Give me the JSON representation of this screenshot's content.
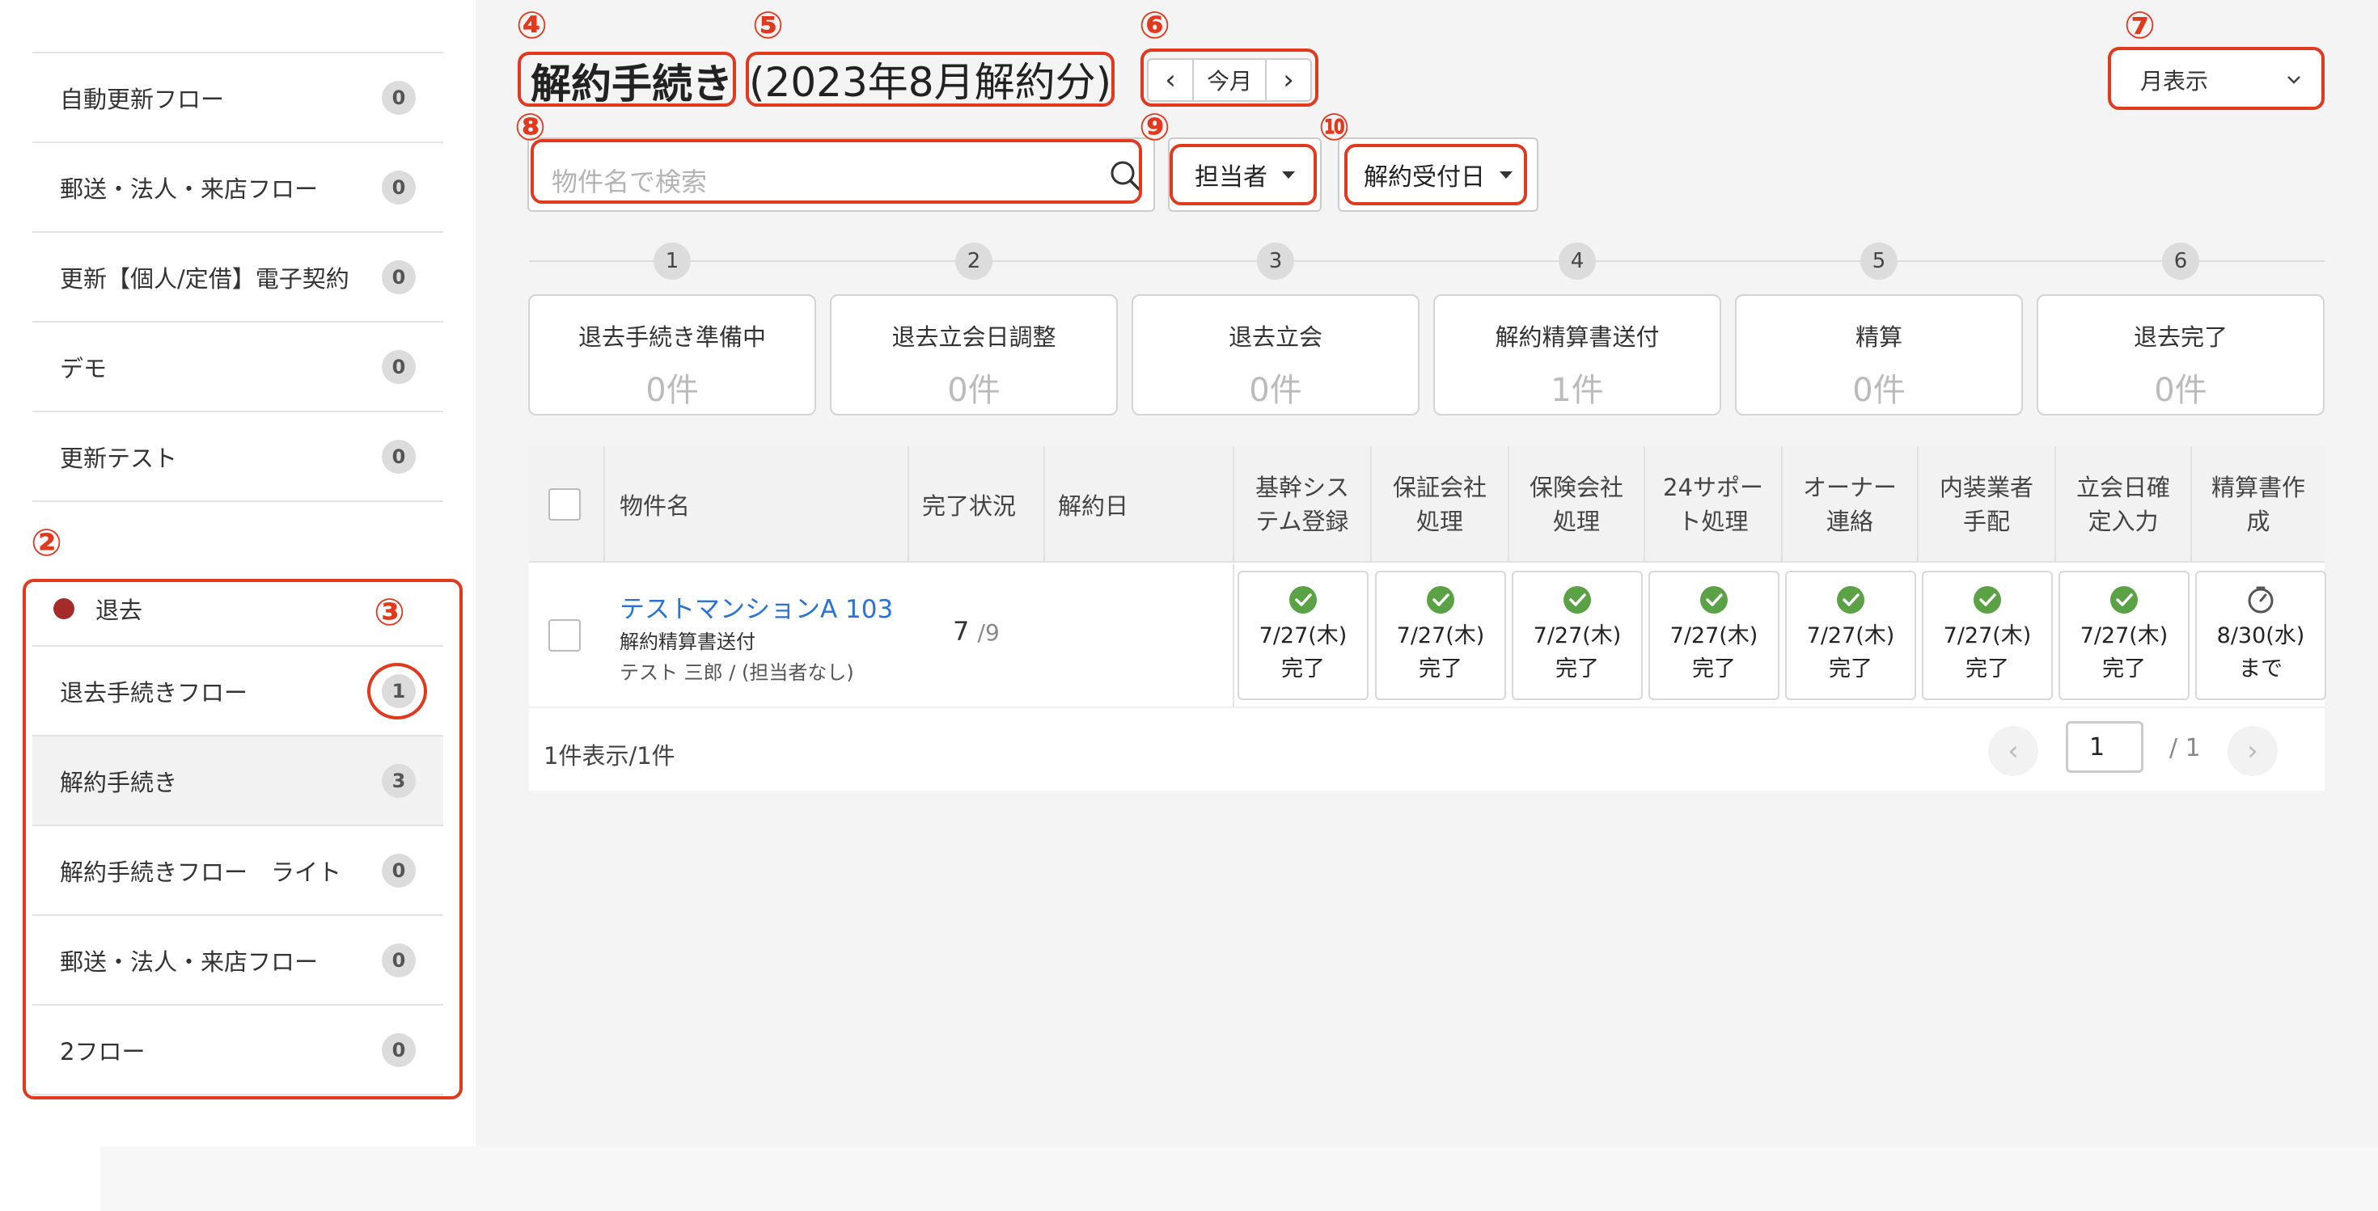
{
  "sidebar": {
    "items_top": [
      {
        "label": "自動更新フロー",
        "count": "0"
      },
      {
        "label": "郵送・法人・来店フロー",
        "count": "0"
      },
      {
        "label": "更新【個人/定借】電子契約",
        "count": "0"
      },
      {
        "label": "デモ",
        "count": "0"
      },
      {
        "label": "更新テスト",
        "count": "0"
      }
    ],
    "group_label": "退去",
    "group_color": "#a52a2a",
    "items_group": [
      {
        "label": "退去手続きフロー",
        "count": "1"
      },
      {
        "label": "解約手続き",
        "count": "3"
      },
      {
        "label": "解約手続きフロー　ライト",
        "count": "0"
      },
      {
        "label": "郵送・法人・来店フロー",
        "count": "0"
      },
      {
        "label": "2フロー",
        "count": "0"
      }
    ]
  },
  "annotations": {
    "n2": "②",
    "n3": "③",
    "n4": "④",
    "n5": "⑤",
    "n6": "⑥",
    "n7": "⑦",
    "n8": "⑧",
    "n9": "⑨",
    "n10": "⑩",
    "color": "#e0391e"
  },
  "header": {
    "title": "解約手続き",
    "period": "(2023年8月解約分)",
    "prev": "‹",
    "today": "今月",
    "next": "›",
    "view_mode": "月表示"
  },
  "filters": {
    "search_placeholder": "物件名で検索",
    "assignee": "担当者",
    "date_type": "解約受付日"
  },
  "steps": [
    {
      "num": "1",
      "label": "退去手続き準備中",
      "count": "0件"
    },
    {
      "num": "2",
      "label": "退去立会日調整",
      "count": "0件"
    },
    {
      "num": "3",
      "label": "退去立会",
      "count": "0件"
    },
    {
      "num": "4",
      "label": "解約精算書送付",
      "count": "1件"
    },
    {
      "num": "5",
      "label": "精算",
      "count": "0件"
    },
    {
      "num": "6",
      "label": "退去完了",
      "count": "0件"
    }
  ],
  "table": {
    "headers": {
      "name": "物件名",
      "progress": "完了状況",
      "cancel_date": "解約日",
      "tasks": [
        [
          "基幹シス",
          "テム登録"
        ],
        [
          "保証会社",
          "処理"
        ],
        [
          "保険会社",
          "処理"
        ],
        [
          "24サポー",
          "ト処理"
        ],
        [
          "オーナー",
          "連絡"
        ],
        [
          "内装業者",
          "手配"
        ],
        [
          "立会日確",
          "定入力"
        ],
        [
          "精算書作",
          "成"
        ]
      ]
    },
    "rows": [
      {
        "name": "テストマンションA  103",
        "status": "解約精算書送付",
        "people": "テスト 三郎 / (担当者なし)",
        "progress_done": "7",
        "progress_total": "/9",
        "tasks": [
          {
            "date": "7/27(木)",
            "state": "完了",
            "icon": "check-circle-icon"
          },
          {
            "date": "7/27(木)",
            "state": "完了",
            "icon": "check-circle-icon"
          },
          {
            "date": "7/27(木)",
            "state": "完了",
            "icon": "check-circle-icon"
          },
          {
            "date": "7/27(木)",
            "state": "完了",
            "icon": "check-circle-icon"
          },
          {
            "date": "7/27(木)",
            "state": "完了",
            "icon": "check-circle-icon"
          },
          {
            "date": "7/27(木)",
            "state": "完了",
            "icon": "check-circle-icon"
          },
          {
            "date": "7/27(木)",
            "state": "完了",
            "icon": "check-circle-icon"
          },
          {
            "date": "8/30(水)",
            "state": "まで",
            "icon": "clock-icon"
          }
        ]
      }
    ]
  },
  "pagination": {
    "summary": "1件表示/1件",
    "prev": "‹",
    "current": "1",
    "total": "/ 1",
    "next": "›"
  },
  "colors": {
    "link": "#2a73d6",
    "done": "#5aa245",
    "accent_red": "#e0391e"
  }
}
